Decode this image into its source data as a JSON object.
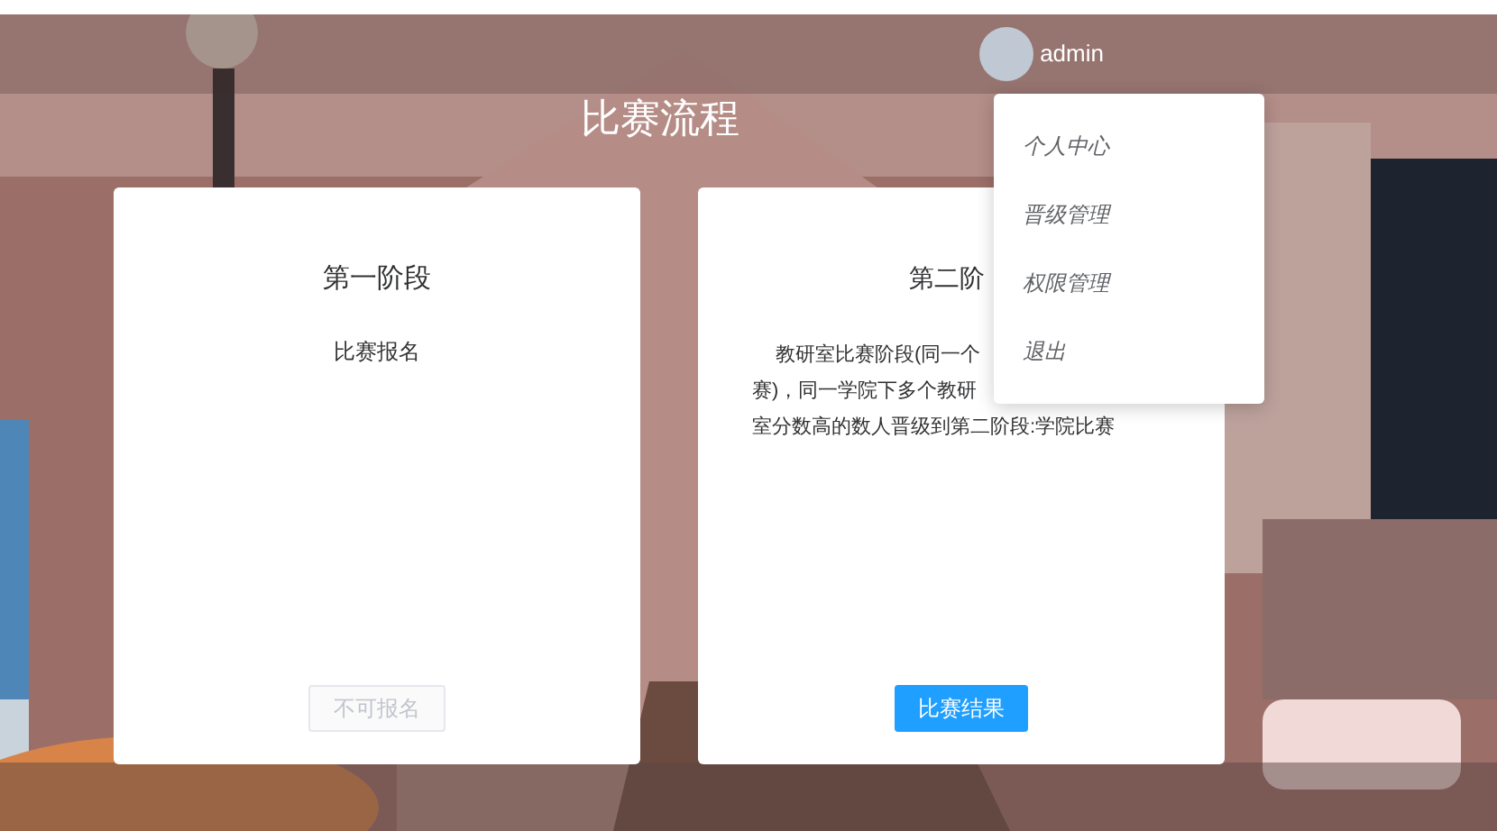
{
  "header": {
    "username": "admin"
  },
  "user_menu": {
    "expanded": true,
    "items": [
      {
        "label": "个人中心"
      },
      {
        "label": "晋级管理"
      },
      {
        "label": "权限管理"
      },
      {
        "label": "退出"
      }
    ]
  },
  "page_title": "比赛流程",
  "stages": [
    {
      "title": "第一阶段",
      "description_lines": [
        "比赛报名"
      ],
      "button": {
        "label": "不可报名",
        "disabled": true
      }
    },
    {
      "title": "第二阶",
      "description_lines": [
        "教研室比赛阶段(同一个",
        "赛)，同一学院下多个教研",
        "室分数高的数人晋级到第二阶段:学院比赛"
      ],
      "button": {
        "label": "比赛结果",
        "disabled": false
      }
    }
  ]
}
